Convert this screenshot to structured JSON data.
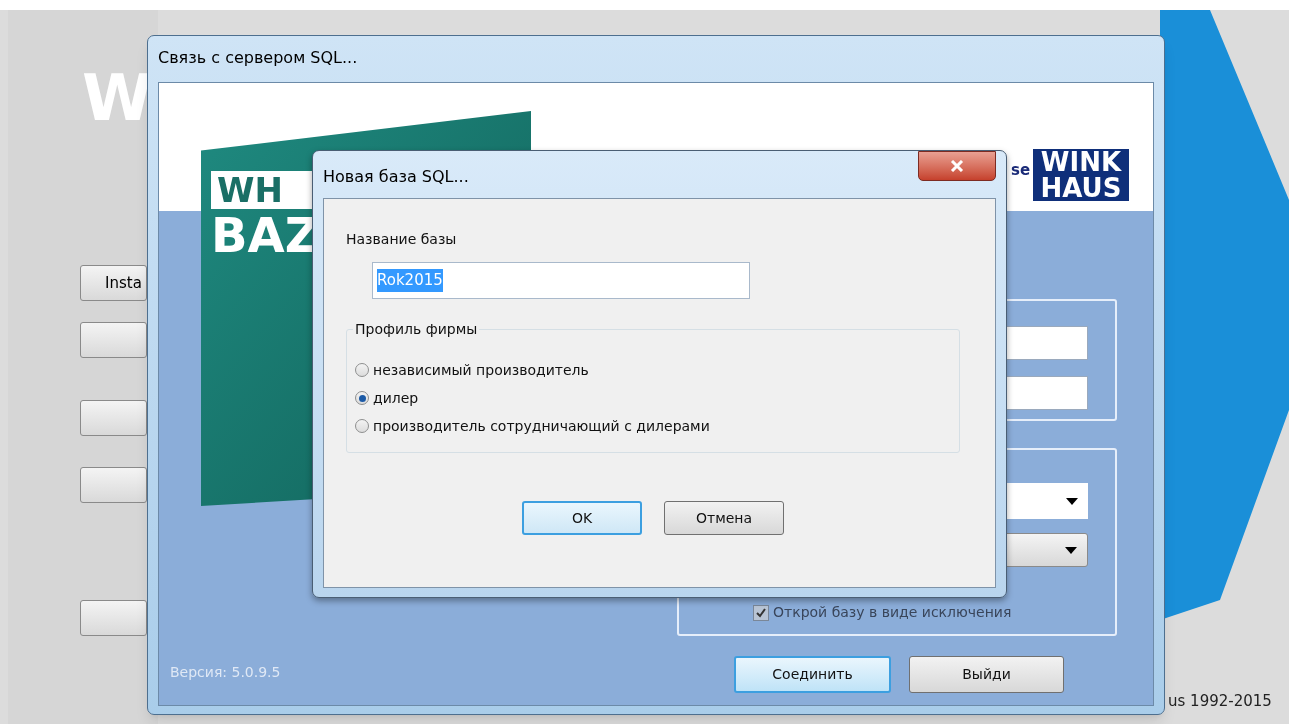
{
  "background": {
    "big_letter": "W",
    "button_label": "Insta",
    "copyright": "us 1992-2015"
  },
  "main_window": {
    "title": "Связь с сервером SQL...",
    "logo": [
      "WINK",
      "HAUS"
    ],
    "logo_caption": "se",
    "box_art": [
      "WH",
      "BAZ"
    ],
    "version": "Версия: 5.0.9.5",
    "checkbox": {
      "label": "Открой базу в виде исключения",
      "checked": true
    },
    "buttons": [
      {
        "label": "Соединить",
        "default": true
      },
      {
        "label": "Выйди",
        "default": false
      }
    ]
  },
  "dialog": {
    "title": "Новая база SQL...",
    "field_label": "Название базы",
    "field": {
      "value": "Rok2015",
      "highlighted": true
    },
    "group": {
      "title": "Профиль фирмы",
      "options": [
        {
          "label": "независимый производитель",
          "selected": false
        },
        {
          "label": "дилер",
          "selected": true
        },
        {
          "label": "производитель сотрудничающий с дилерами",
          "selected": false
        }
      ]
    },
    "buttons": [
      {
        "label": "OK",
        "default": true
      },
      {
        "label": "Отмена",
        "default": false
      }
    ]
  }
}
